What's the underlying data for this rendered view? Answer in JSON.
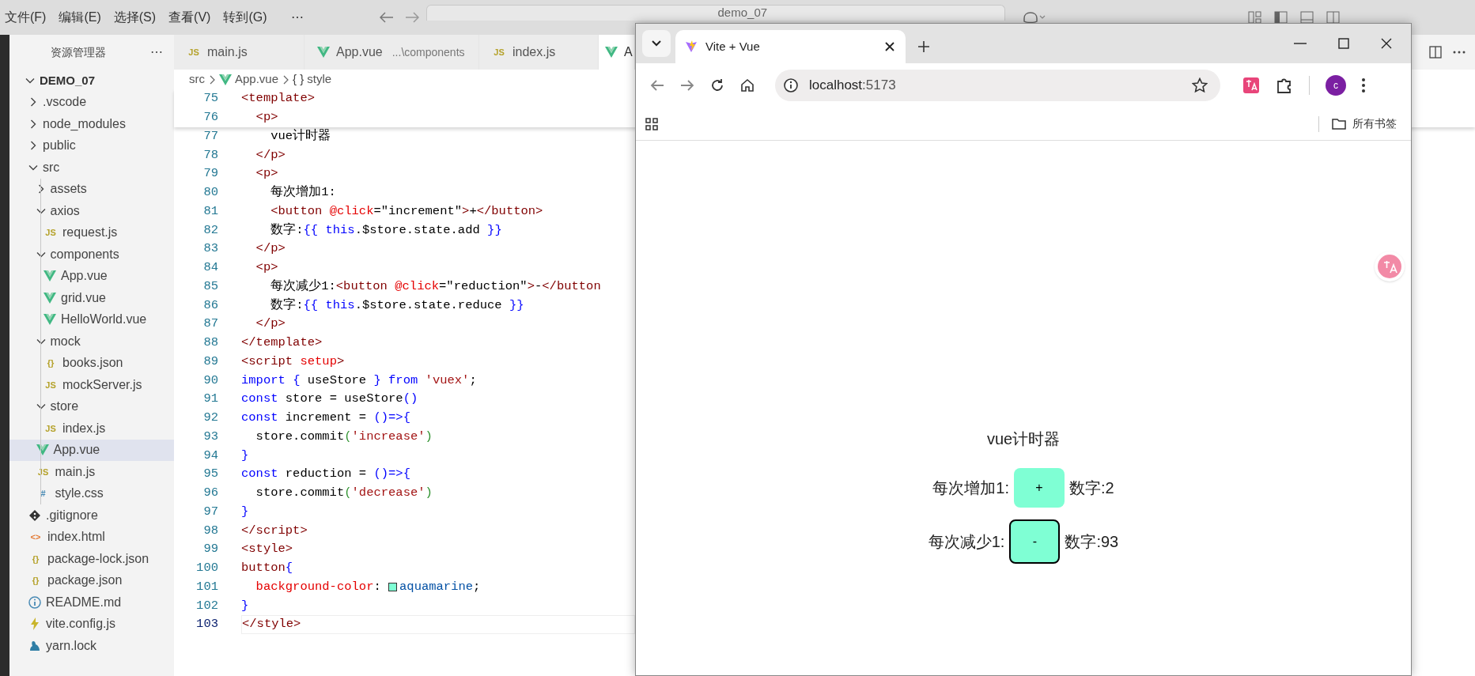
{
  "vscode": {
    "menu": [
      "文件(F)",
      "编辑(E)",
      "选择(S)",
      "查看(V)",
      "转到(G)",
      "⋯"
    ],
    "search": "demo_07",
    "sidebar": {
      "title": "资源管理器",
      "more": "⋯",
      "tree": [
        {
          "label": "DEMO_07",
          "kind": "folder",
          "expanded": true,
          "selected": false,
          "children": [
            {
              "label": ".vscode",
              "kind": "folder",
              "expanded": false,
              "selected": false
            },
            {
              "label": "node_modules",
              "kind": "folder",
              "expanded": false,
              "selected": false
            },
            {
              "label": "public",
              "kind": "folder",
              "expanded": false,
              "selected": false
            },
            {
              "label": "src",
              "kind": "folder",
              "expanded": true,
              "selected": false,
              "children": [
                {
                  "label": "assets",
                  "kind": "folder",
                  "expanded": false,
                  "selected": false
                },
                {
                  "label": "axios",
                  "kind": "folder",
                  "expanded": true,
                  "selected": false,
                  "children": [
                    {
                      "label": "request.js",
                      "kind": "js",
                      "icon": "JS",
                      "selected": false
                    }
                  ]
                },
                {
                  "label": "components",
                  "kind": "folder",
                  "expanded": true,
                  "selected": false,
                  "children": [
                    {
                      "label": "App.vue",
                      "kind": "vue",
                      "selected": false
                    },
                    {
                      "label": "grid.vue",
                      "kind": "vue",
                      "selected": false
                    },
                    {
                      "label": "HelloWorld.vue",
                      "kind": "vue",
                      "selected": false
                    }
                  ]
                },
                {
                  "label": "mock",
                  "kind": "folder",
                  "expanded": true,
                  "selected": false,
                  "children": [
                    {
                      "label": "books.json",
                      "kind": "json",
                      "icon": "{}",
                      "selected": false
                    },
                    {
                      "label": "mockServer.js",
                      "kind": "js",
                      "icon": "JS",
                      "selected": false
                    }
                  ]
                },
                {
                  "label": "store",
                  "kind": "folder",
                  "expanded": true,
                  "selected": false,
                  "children": [
                    {
                      "label": "index.js",
                      "kind": "js",
                      "icon": "JS",
                      "selected": false
                    }
                  ]
                },
                {
                  "label": "App.vue",
                  "kind": "vue",
                  "selected": true
                },
                {
                  "label": "main.js",
                  "kind": "js",
                  "icon": "JS",
                  "selected": false
                },
                {
                  "label": "style.css",
                  "kind": "css",
                  "icon": "#",
                  "selected": false
                }
              ]
            },
            {
              "label": ".gitignore",
              "kind": "git",
              "selected": false
            },
            {
              "label": "index.html",
              "kind": "html",
              "icon": "<>",
              "selected": false
            },
            {
              "label": "package-lock.json",
              "kind": "json",
              "icon": "{}",
              "selected": false
            },
            {
              "label": "package.json",
              "kind": "json",
              "icon": "{}",
              "selected": false
            },
            {
              "label": "README.md",
              "kind": "info",
              "selected": false
            },
            {
              "label": "vite.config.js",
              "kind": "vite",
              "selected": false
            },
            {
              "label": "yarn.lock",
              "kind": "yarn",
              "selected": false
            }
          ]
        }
      ]
    },
    "tabs": [
      {
        "label": "main.js",
        "kind": "js",
        "icon": "JS",
        "selected": false
      },
      {
        "label": "App.vue",
        "detail": "...\\components",
        "kind": "vue",
        "selected": false
      },
      {
        "label": "index.js",
        "kind": "js",
        "icon": "JS",
        "selected": false
      },
      {
        "label": "A",
        "kind": "vue",
        "selected": true
      }
    ],
    "breadcrumb": [
      {
        "text": "src",
        "kind": "folder"
      },
      {
        "text": "App.vue",
        "kind": "vue"
      },
      {
        "text": "style",
        "kind": "symbol",
        "icon": "{ }"
      }
    ],
    "code": {
      "sticky": [
        {
          "number": "75",
          "current": false,
          "tokens": [
            {
              "text": "<template>",
              "kind": "tag"
            }
          ]
        },
        {
          "number": "76",
          "current": false,
          "tokens": [
            {
              "text": "  <p>",
              "kind": "tag"
            }
          ]
        }
      ],
      "lines": [
        {
          "number": "77",
          "current": false,
          "tokens": [
            {
              "text": "    vue计时器",
              "kind": "plain"
            }
          ]
        },
        {
          "number": "78",
          "current": false,
          "tokens": [
            {
              "text": "  </p>",
              "kind": "tag"
            }
          ]
        },
        {
          "number": "79",
          "current": false,
          "tokens": [
            {
              "text": "  <p>",
              "kind": "tag"
            }
          ]
        },
        {
          "number": "80",
          "current": false,
          "tokens": [
            {
              "text": "    每次增加1:",
              "kind": "plain"
            }
          ]
        },
        {
          "number": "81",
          "current": false,
          "tokens": [
            {
              "text": "    <button ",
              "kind": "tag"
            },
            {
              "text": "@click",
              "kind": "attr"
            },
            {
              "text": "=\"increment\"",
              "kind": "plain"
            },
            {
              "text": ">",
              "kind": "tag"
            },
            {
              "text": "+",
              "kind": "plain"
            },
            {
              "text": "</button>",
              "kind": "tag"
            }
          ]
        },
        {
          "number": "82",
          "current": false,
          "tokens": [
            {
              "text": "    数字:",
              "kind": "plain"
            },
            {
              "text": "{{ ",
              "kind": "interp"
            },
            {
              "text": "this",
              "kind": "kw"
            },
            {
              "text": ".$store.state.add ",
              "kind": "plain"
            },
            {
              "text": "}}",
              "kind": "interp"
            }
          ]
        },
        {
          "number": "83",
          "current": false,
          "tokens": [
            {
              "text": "  </p>",
              "kind": "tag"
            }
          ]
        },
        {
          "number": "84",
          "current": false,
          "tokens": [
            {
              "text": "  <p>",
              "kind": "tag"
            }
          ]
        },
        {
          "number": "85",
          "current": false,
          "tokens": [
            {
              "text": "    每次减少1:",
              "kind": "plain"
            },
            {
              "text": "<button ",
              "kind": "tag"
            },
            {
              "text": "@click",
              "kind": "attr"
            },
            {
              "text": "=\"reduction\"",
              "kind": "plain"
            },
            {
              "text": ">",
              "kind": "tag"
            },
            {
              "text": "-",
              "kind": "plain"
            },
            {
              "text": "</button",
              "kind": "tag"
            }
          ]
        },
        {
          "number": "86",
          "current": false,
          "tokens": [
            {
              "text": "    数字:",
              "kind": "plain"
            },
            {
              "text": "{{ ",
              "kind": "interp"
            },
            {
              "text": "this",
              "kind": "kw"
            },
            {
              "text": ".$store.state.reduce ",
              "kind": "plain"
            },
            {
              "text": "}}",
              "kind": "interp"
            }
          ]
        },
        {
          "number": "87",
          "current": false,
          "tokens": [
            {
              "text": "  </p>",
              "kind": "tag"
            }
          ]
        },
        {
          "number": "88",
          "current": false,
          "tokens": [
            {
              "text": "</template>",
              "kind": "tag"
            }
          ]
        },
        {
          "number": "89",
          "current": false,
          "tokens": [
            {
              "text": "<script ",
              "kind": "tag"
            },
            {
              "text": "setup",
              "kind": "attr"
            },
            {
              "text": ">",
              "kind": "tag"
            }
          ]
        },
        {
          "number": "90",
          "current": false,
          "tokens": [
            {
              "text": "import ",
              "kind": "kw"
            },
            {
              "text": "{",
              "kind": "brace"
            },
            {
              "text": " useStore ",
              "kind": "plain"
            },
            {
              "text": "}",
              "kind": "brace"
            },
            {
              "text": " from ",
              "kind": "kw"
            },
            {
              "text": "'vuex'",
              "kind": "str"
            },
            {
              "text": ";",
              "kind": "plain"
            }
          ]
        },
        {
          "number": "91",
          "current": false,
          "tokens": [
            {
              "text": "const",
              "kind": "kw"
            },
            {
              "text": " store = useStore",
              "kind": "plain"
            },
            {
              "text": "()",
              "kind": "brace"
            }
          ]
        },
        {
          "number": "92",
          "current": false,
          "tokens": [
            {
              "text": "const",
              "kind": "kw"
            },
            {
              "text": " increment = ",
              "kind": "plain"
            },
            {
              "text": "()=>{",
              "kind": "brace"
            }
          ]
        },
        {
          "number": "93",
          "current": false,
          "tokens": [
            {
              "text": "  store.commit",
              "kind": "plain"
            },
            {
              "text": "(",
              "kind": "paren"
            },
            {
              "text": "'increase'",
              "kind": "str"
            },
            {
              "text": ")",
              "kind": "paren"
            }
          ]
        },
        {
          "number": "94",
          "current": false,
          "tokens": [
            {
              "text": "}",
              "kind": "brace"
            }
          ]
        },
        {
          "number": "95",
          "current": false,
          "tokens": [
            {
              "text": "const",
              "kind": "kw"
            },
            {
              "text": " reduction = ",
              "kind": "plain"
            },
            {
              "text": "()=>{",
              "kind": "brace"
            }
          ]
        },
        {
          "number": "96",
          "current": false,
          "tokens": [
            {
              "text": "  store.commit",
              "kind": "plain"
            },
            {
              "text": "(",
              "kind": "paren"
            },
            {
              "text": "'decrease'",
              "kind": "str"
            },
            {
              "text": ")",
              "kind": "paren"
            }
          ]
        },
        {
          "number": "97",
          "current": false,
          "tokens": [
            {
              "text": "}",
              "kind": "brace"
            }
          ]
        },
        {
          "number": "98",
          "current": false,
          "tokens": [
            {
              "text": "</script>",
              "kind": "tag"
            }
          ]
        },
        {
          "number": "99",
          "current": false,
          "tokens": [
            {
              "text": "<style>",
              "kind": "tag"
            }
          ]
        },
        {
          "number": "100",
          "current": false,
          "tokens": [
            {
              "text": "button",
              "kind": "tag"
            },
            {
              "text": "{",
              "kind": "brace"
            }
          ]
        },
        {
          "number": "101",
          "current": false,
          "tokens": [
            {
              "text": "  background-color",
              "kind": "prop"
            },
            {
              "text": ": ",
              "kind": "plain"
            },
            {
              "kind": "swatch",
              "color": "#7fffd4"
            },
            {
              "text": "aquamarine",
              "kind": "val"
            },
            {
              "text": ";",
              "kind": "plain"
            }
          ]
        },
        {
          "number": "102",
          "current": false,
          "tokens": [
            {
              "text": "}",
              "kind": "brace"
            }
          ]
        },
        {
          "number": "103",
          "current": true,
          "tokens": [
            {
              "text": "</style>",
              "kind": "tag"
            }
          ]
        }
      ]
    }
  },
  "browser": {
    "tabs": [
      {
        "title": "Vite + Vue",
        "selected": true
      }
    ],
    "address": {
      "host": "localhost",
      "port": ":5173"
    },
    "avatar": "c",
    "bookmarks": [
      {
        "label": "所有书签"
      }
    ],
    "page": {
      "heading": "vue计时器",
      "rows": [
        {
          "label": "每次增加1:",
          "button": "+",
          "focused": false,
          "value": "数字:2"
        },
        {
          "label": "每次减少1:",
          "button": "-",
          "focused": true,
          "value": "数字:93"
        }
      ]
    }
  }
}
